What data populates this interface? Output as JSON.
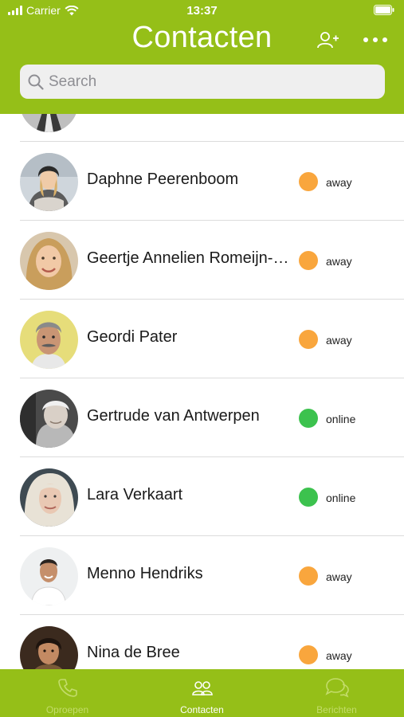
{
  "status_bar": {
    "carrier": "Carrier",
    "time": "13:37"
  },
  "header": {
    "title": "Contacten"
  },
  "search": {
    "placeholder": "Search"
  },
  "contacts": [
    {
      "name": "",
      "status": "",
      "status_color": "#ffffff"
    },
    {
      "name": "Daphne Peerenboom",
      "status": "away",
      "status_color": "#f9a63d"
    },
    {
      "name": "Geertje Annelien Romeijn-Snijders",
      "status": "away",
      "status_color": "#f9a63d"
    },
    {
      "name": "Geordi Pater",
      "status": "away",
      "status_color": "#f9a63d"
    },
    {
      "name": "Gertrude van Antwerpen",
      "status": "online",
      "status_color": "#3cc24e"
    },
    {
      "name": "Lara Verkaart",
      "status": "online",
      "status_color": "#3cc24e"
    },
    {
      "name": "Menno Hendriks",
      "status": "away",
      "status_color": "#f9a63d"
    },
    {
      "name": "Nina de Bree",
      "status": "away",
      "status_color": "#f9a63d"
    }
  ],
  "tabs": [
    {
      "label": "Oproepen",
      "icon": "phone-icon",
      "active": false
    },
    {
      "label": "Contacten",
      "icon": "contacts-icon",
      "active": true
    },
    {
      "label": "Berichten",
      "icon": "chat-icon",
      "active": false
    }
  ],
  "colors": {
    "brand_green": "#95bf18",
    "away": "#f9a63d",
    "online": "#3cc24e"
  }
}
